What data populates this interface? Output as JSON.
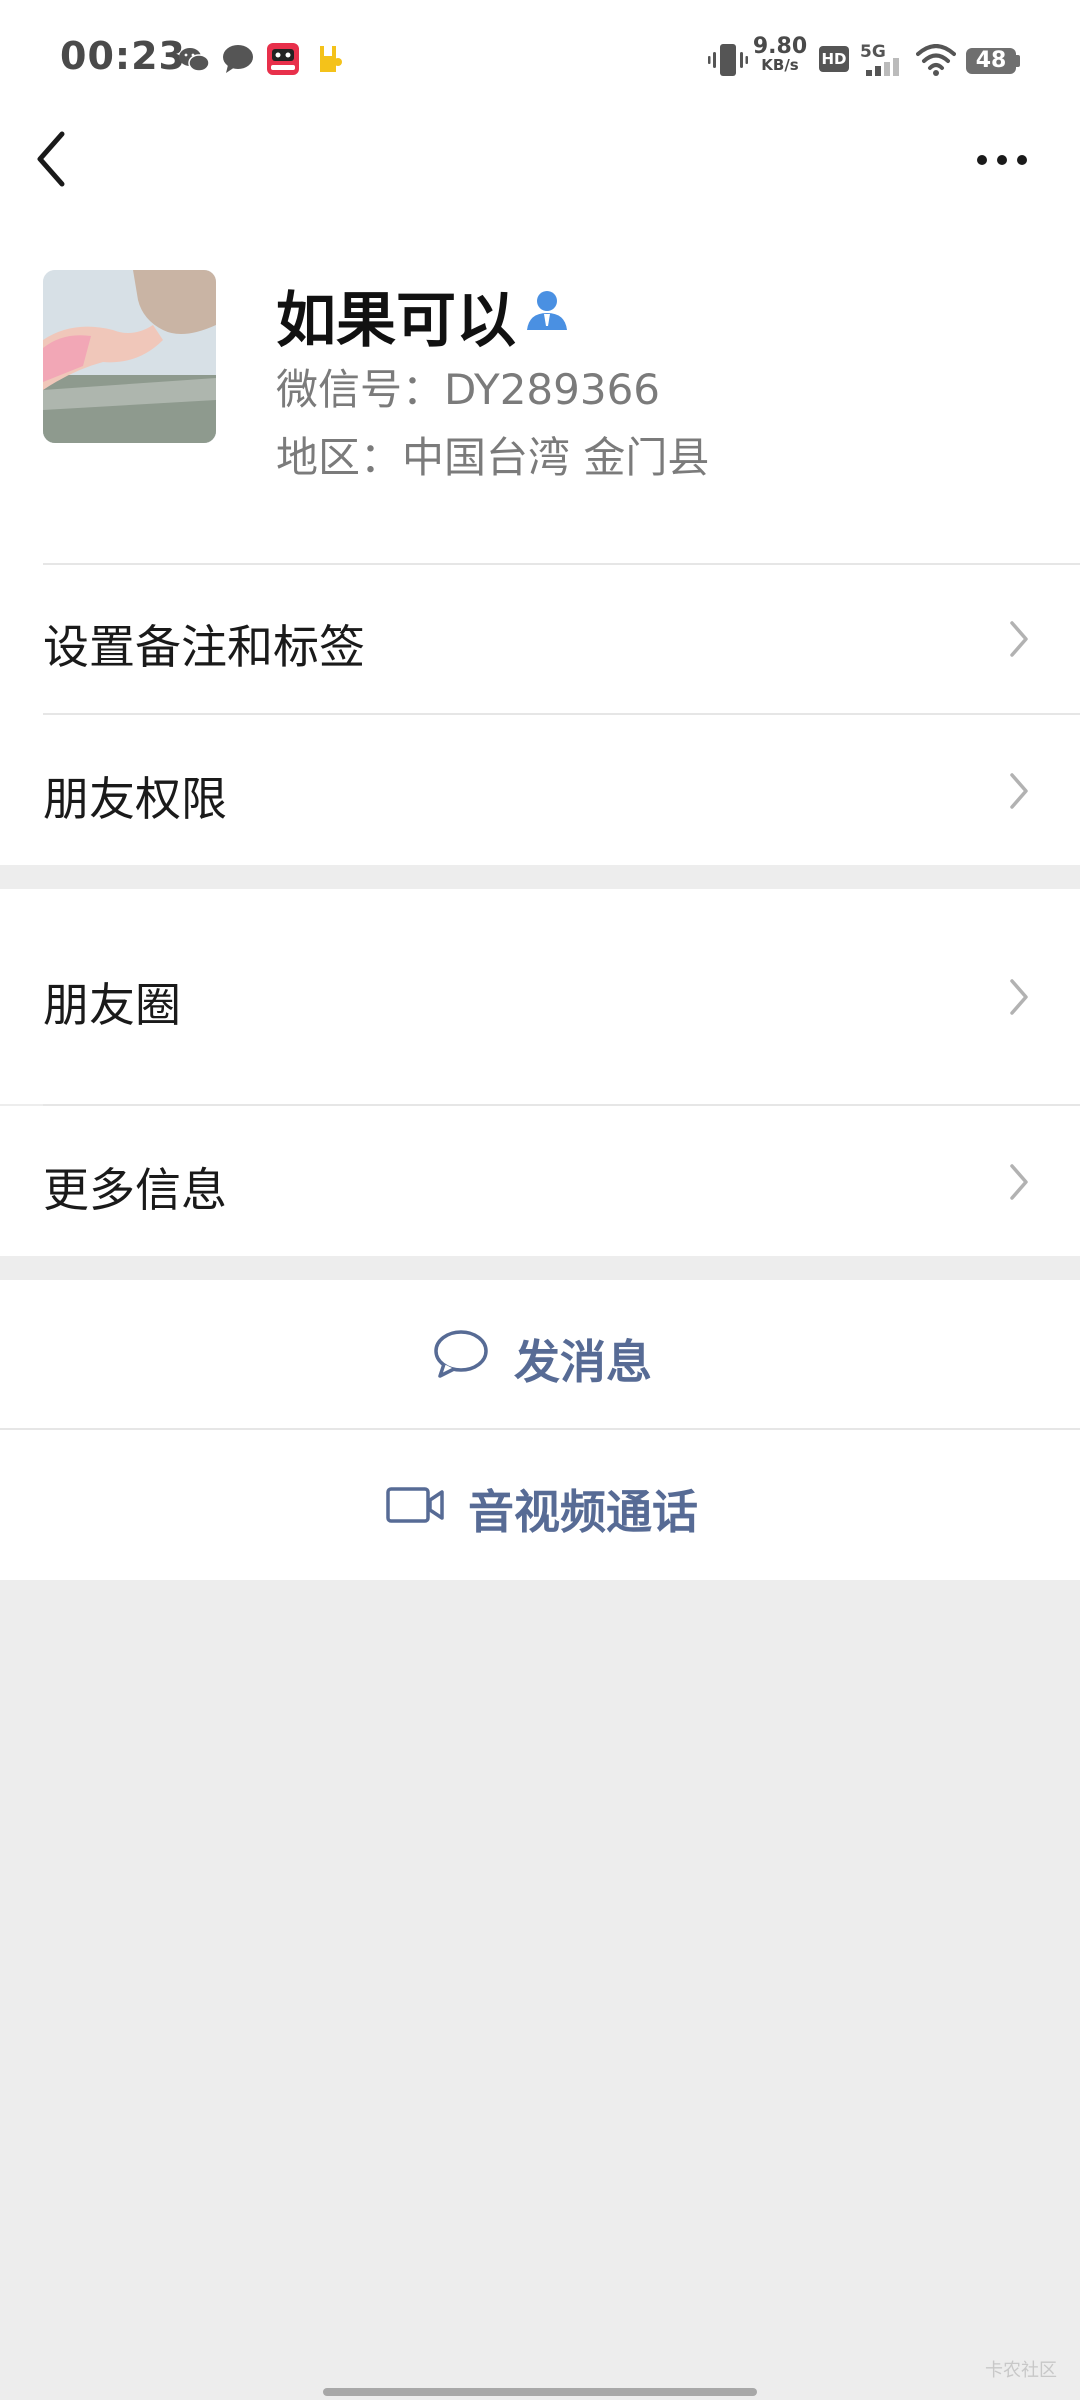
{
  "status_bar": {
    "time": "00:23",
    "net_speed_value": "9.80",
    "net_speed_unit": "KB/s",
    "hd_label": "HD",
    "network_label": "5G",
    "battery_level": "48",
    "notification_icons": [
      "wechat-icon",
      "chat-bubble-icon",
      "red-app-icon",
      "yellow-app-icon"
    ],
    "system_icons": [
      "vibrate-icon",
      "signal-icon",
      "wifi-icon",
      "battery-icon"
    ]
  },
  "header": {
    "back_icon": "chevron-left-icon",
    "more_icon": "more-dots-icon"
  },
  "profile": {
    "name": "如果可以",
    "wechat_id": "微信号：DY289366",
    "region": "地区：中国台湾  金门县",
    "badge_icon": "person-icon",
    "accent_color": "#4a90e2"
  },
  "menu": {
    "remark_tags": "设置备注和标签",
    "friend_permissions": "朋友权限",
    "moments": "朋友圈",
    "more_info": "更多信息"
  },
  "actions": {
    "send_message": "发消息",
    "video_call": "音视频通话",
    "link_color": "#576b95"
  },
  "watermark": "卡农社区"
}
